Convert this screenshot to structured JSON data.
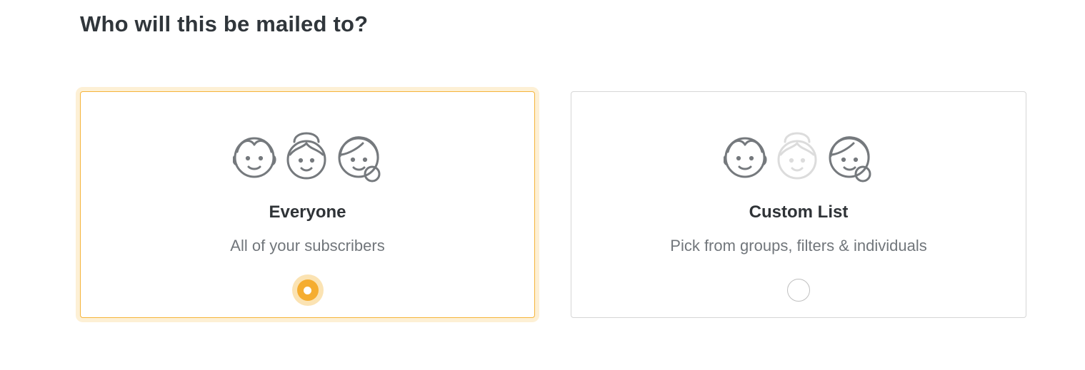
{
  "heading": "Who will this be mailed to?",
  "options": [
    {
      "title": "Everyone",
      "description": "All of your subscribers",
      "selected": true,
      "icon": "three-faces-icon",
      "accent_color": "#f5ad30"
    },
    {
      "title": "Custom List",
      "description": "Pick from groups, filters & individuals",
      "selected": false,
      "icon": "three-faces-middle-faded-icon"
    }
  ],
  "colors": {
    "accent": "#f5ad30",
    "accent_light": "#fdf0d5",
    "icon_stroke": "#75797d",
    "icon_faded": "#d9d9d9"
  }
}
